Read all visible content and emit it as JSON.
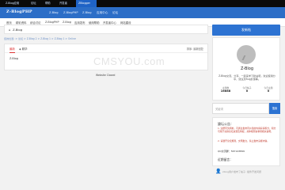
{
  "topbar": {
    "tabs": [
      "Z-Blog应用",
      "论坛",
      "帮助",
      "开发者",
      "ZBlogger"
    ],
    "active_index": 4
  },
  "header": {
    "logo": "Z-BlogPHP",
    "nav": [
      "Z-Blog",
      "Z-BlogPHP",
      "Z-Blog",
      "应用中心",
      "论坛"
    ]
  },
  "subnav": [
    "首页",
    "精彩资料",
    "综合讨论",
    "Z-BlogPHP",
    "Z-Blog",
    "应用发布",
    "使用帮助",
    "开发者中心",
    "网站建设"
  ],
  "page": {
    "title": "Z-Blog",
    "breadcrumb": "您的位置: > 论坛 > Z-Blog 2 > Z-Blog 1 > Z-Blog 1 > Online",
    "feed_tabs": [
      "最新",
      "精华"
    ],
    "sort_label": "排序: 最新回复",
    "row": "Z-Blog",
    "footer": "Website Closed",
    "watermark": "CMSYOU.com"
  },
  "sidebar": {
    "post_button": "发新帖",
    "profile": {
      "name": "Z-Blog",
      "description": "Z-Blog交流、分享、一起来学习建站吧，欢迎使用分享，建议及Bug反馈等。",
      "stats": [
        {
          "label": "主题数",
          "value": "16888"
        },
        {
          "label": "今日帖子",
          "value": "0"
        },
        {
          "label": "今日主题",
          "value": "0"
        }
      ]
    },
    "search": {
      "placeholder": "关键词",
      "button": "搜索"
    },
    "notice": {
      "title": "論坛公告：",
      "lines": [
        "1. 注册有奖机制，可通过发布有价值的内容获得积分，积分可用于兑换论坛资源及特权，具体规则请参阅相关说明。",
        "2. 请遵守论坛规则，文明发言，禁止发布违规内容。"
      ],
      "qq": "QQ交流群：567143899",
      "recent_title": "近期留言："
    },
    "recent_item": "zblog用户发布了帖子: 插件开发问题"
  }
}
